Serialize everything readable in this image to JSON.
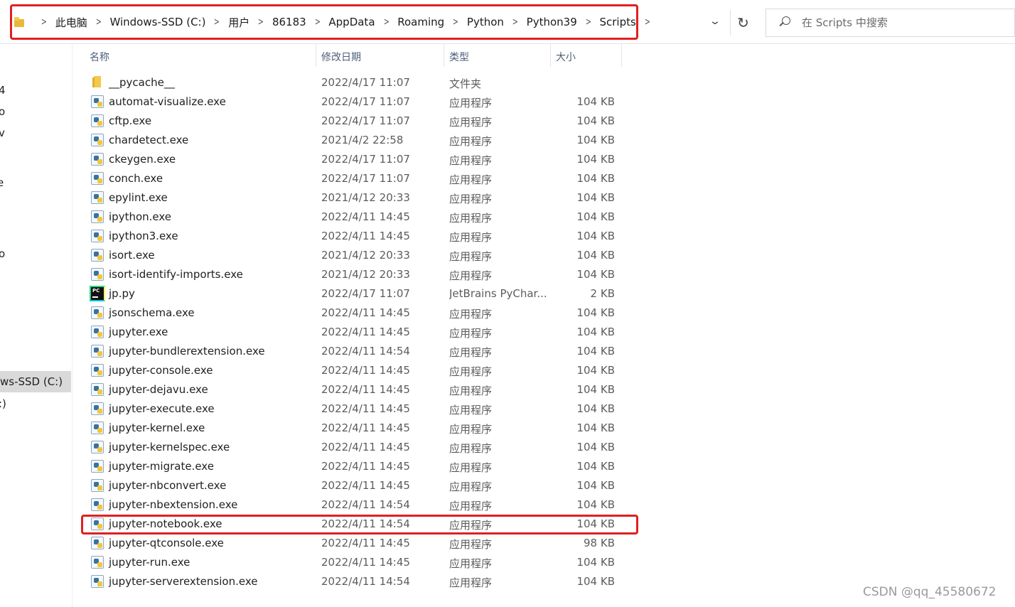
{
  "address_bar": {
    "breadcrumbs": [
      "此电脑",
      "Windows-SSD (C:)",
      "用户",
      "86183",
      "AppData",
      "Roaming",
      "Python",
      "Python39",
      "Scripts"
    ]
  },
  "search": {
    "placeholder": "在 Scripts 中搜索"
  },
  "nav": {
    "items": [
      {
        "label": "4"
      },
      {
        "label": "o"
      },
      {
        "label": "v"
      },
      {
        "label": "e"
      },
      {
        "label": "o"
      },
      {
        "label": "ws-SSD (C:)"
      },
      {
        "label": ":)"
      }
    ]
  },
  "columns": {
    "name": "名称",
    "date": "修改日期",
    "type": "类型",
    "size": "大小"
  },
  "files": [
    {
      "name": "__pycache__",
      "date": "2022/4/17 11:07",
      "type": "文件夹",
      "size": "",
      "icon": "folder-icon"
    },
    {
      "name": "automat-visualize.exe",
      "date": "2022/4/17 11:07",
      "type": "应用程序",
      "size": "104 KB",
      "icon": "python-exe-icon"
    },
    {
      "name": "cftp.exe",
      "date": "2022/4/17 11:07",
      "type": "应用程序",
      "size": "104 KB",
      "icon": "python-exe-icon"
    },
    {
      "name": "chardetect.exe",
      "date": "2021/4/2 22:58",
      "type": "应用程序",
      "size": "104 KB",
      "icon": "python-exe-icon"
    },
    {
      "name": "ckeygen.exe",
      "date": "2022/4/17 11:07",
      "type": "应用程序",
      "size": "104 KB",
      "icon": "python-exe-icon"
    },
    {
      "name": "conch.exe",
      "date": "2022/4/17 11:07",
      "type": "应用程序",
      "size": "104 KB",
      "icon": "python-exe-icon"
    },
    {
      "name": "epylint.exe",
      "date": "2021/4/12 20:33",
      "type": "应用程序",
      "size": "104 KB",
      "icon": "python-exe-icon"
    },
    {
      "name": "ipython.exe",
      "date": "2022/4/11 14:45",
      "type": "应用程序",
      "size": "104 KB",
      "icon": "python-exe-icon"
    },
    {
      "name": "ipython3.exe",
      "date": "2022/4/11 14:45",
      "type": "应用程序",
      "size": "104 KB",
      "icon": "python-exe-icon"
    },
    {
      "name": "isort.exe",
      "date": "2021/4/12 20:33",
      "type": "应用程序",
      "size": "104 KB",
      "icon": "python-exe-icon"
    },
    {
      "name": "isort-identify-imports.exe",
      "date": "2021/4/12 20:33",
      "type": "应用程序",
      "size": "104 KB",
      "icon": "python-exe-icon"
    },
    {
      "name": "jp.py",
      "date": "2022/4/17 11:07",
      "type": "JetBrains PyChar...",
      "size": "2 KB",
      "icon": "pycharm-icon"
    },
    {
      "name": "jsonschema.exe",
      "date": "2022/4/11 14:45",
      "type": "应用程序",
      "size": "104 KB",
      "icon": "python-exe-icon"
    },
    {
      "name": "jupyter.exe",
      "date": "2022/4/11 14:45",
      "type": "应用程序",
      "size": "104 KB",
      "icon": "python-exe-icon"
    },
    {
      "name": "jupyter-bundlerextension.exe",
      "date": "2022/4/11 14:54",
      "type": "应用程序",
      "size": "104 KB",
      "icon": "python-exe-icon"
    },
    {
      "name": "jupyter-console.exe",
      "date": "2022/4/11 14:45",
      "type": "应用程序",
      "size": "104 KB",
      "icon": "python-exe-icon"
    },
    {
      "name": "jupyter-dejavu.exe",
      "date": "2022/4/11 14:45",
      "type": "应用程序",
      "size": "104 KB",
      "icon": "python-exe-icon"
    },
    {
      "name": "jupyter-execute.exe",
      "date": "2022/4/11 14:45",
      "type": "应用程序",
      "size": "104 KB",
      "icon": "python-exe-icon"
    },
    {
      "name": "jupyter-kernel.exe",
      "date": "2022/4/11 14:45",
      "type": "应用程序",
      "size": "104 KB",
      "icon": "python-exe-icon"
    },
    {
      "name": "jupyter-kernelspec.exe",
      "date": "2022/4/11 14:45",
      "type": "应用程序",
      "size": "104 KB",
      "icon": "python-exe-icon"
    },
    {
      "name": "jupyter-migrate.exe",
      "date": "2022/4/11 14:45",
      "type": "应用程序",
      "size": "104 KB",
      "icon": "python-exe-icon"
    },
    {
      "name": "jupyter-nbconvert.exe",
      "date": "2022/4/11 14:45",
      "type": "应用程序",
      "size": "104 KB",
      "icon": "python-exe-icon"
    },
    {
      "name": "jupyter-nbextension.exe",
      "date": "2022/4/11 14:54",
      "type": "应用程序",
      "size": "104 KB",
      "icon": "python-exe-icon"
    },
    {
      "name": "jupyter-notebook.exe",
      "date": "2022/4/11 14:54",
      "type": "应用程序",
      "size": "104 KB",
      "icon": "python-exe-icon",
      "highlighted": true
    },
    {
      "name": "jupyter-qtconsole.exe",
      "date": "2022/4/11 14:45",
      "type": "应用程序",
      "size": "98 KB",
      "icon": "python-exe-icon"
    },
    {
      "name": "jupyter-run.exe",
      "date": "2022/4/11 14:45",
      "type": "应用程序",
      "size": "104 KB",
      "icon": "python-exe-icon"
    },
    {
      "name": "jupyter-serverextension.exe",
      "date": "2022/4/11 14:54",
      "type": "应用程序",
      "size": "104 KB",
      "icon": "python-exe-icon"
    }
  ],
  "watermark": "CSDN @qq_45580672",
  "colors": {
    "highlight_box": "#e02020",
    "column_header_text": "#4c607a",
    "nav_selected_bg": "#d9d9d9"
  }
}
